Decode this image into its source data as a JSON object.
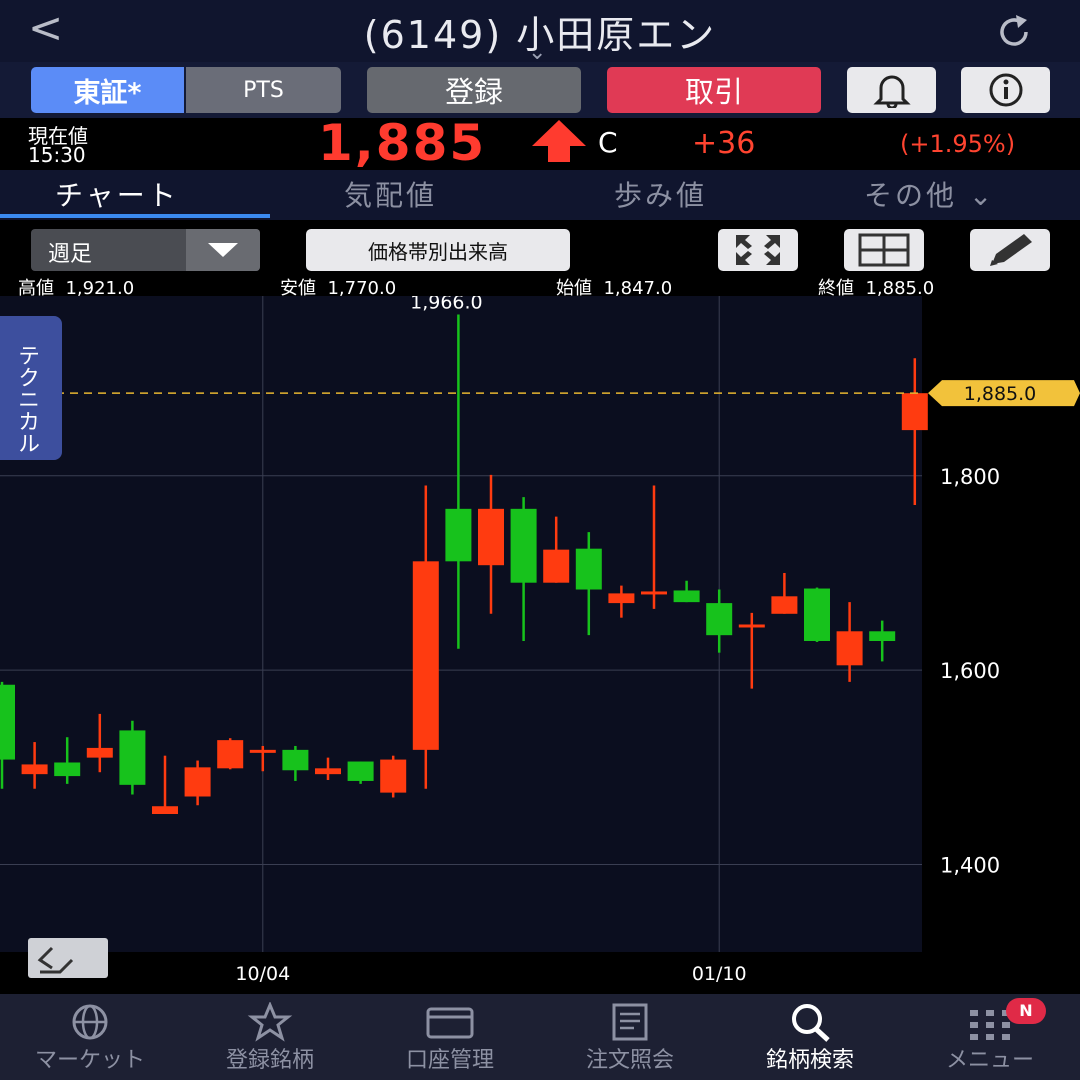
{
  "header": {
    "back_glyph": "<",
    "title": "(6149) 小田原エン",
    "title_chevron": "⌄",
    "refresh_icon": "refresh-icon"
  },
  "toolbar": {
    "tse_label": "東証*",
    "pts_label": "PTS",
    "register_label": "登録",
    "trade_label": "取引",
    "bell_icon": "bell-icon",
    "info_icon": "info-icon"
  },
  "price": {
    "label": "現在値",
    "time": "15:30",
    "value": "1,885",
    "flag": "C",
    "change": "+36",
    "change_pct": "(+1.95%)",
    "up_color": "#ff3b2f"
  },
  "tabs": [
    {
      "label": "チャート",
      "active": true
    },
    {
      "label": "気配値"
    },
    {
      "label": "歩み値"
    },
    {
      "label": "その他 ⌄"
    }
  ],
  "controls": {
    "period": "週足",
    "volume_button": "価格帯別出来高"
  },
  "ohlc": [
    {
      "label": "高値",
      "value": "1,921.0"
    },
    {
      "label": "安値",
      "value": "1,770.0"
    },
    {
      "label": "始値",
      "value": "1,847.0"
    },
    {
      "label": "終値",
      "value": "1,885.0"
    }
  ],
  "chart_data": {
    "type": "candlestick",
    "y_axis": {
      "ticks": [
        1400,
        1600,
        1800
      ],
      "tick_labels": [
        "1,400",
        "1,600",
        "1,800"
      ],
      "range": [
        1310,
        1985
      ]
    },
    "x_axis": {
      "tick_labels": [
        "10/04",
        "01/10"
      ],
      "tick_index": [
        8,
        22
      ]
    },
    "high_annotation": "1,966.0",
    "current_label": "1,885.0",
    "current_value": 1885,
    "up_color": "#17c21c",
    "down_color": "#ff3b10",
    "candles": [
      {
        "o": 1508,
        "h": 1588,
        "l": 1478,
        "c": 1585
      },
      {
        "o": 1503,
        "h": 1526,
        "l": 1478,
        "c": 1493
      },
      {
        "o": 1491,
        "h": 1531,
        "l": 1483,
        "c": 1505
      },
      {
        "o": 1520,
        "h": 1555,
        "l": 1495,
        "c": 1510
      },
      {
        "o": 1482,
        "h": 1548,
        "l": 1472,
        "c": 1538
      },
      {
        "o": 1460,
        "h": 1512,
        "l": 1454,
        "c": 1452
      },
      {
        "o": 1500,
        "h": 1507,
        "l": 1461,
        "c": 1470
      },
      {
        "o": 1528,
        "h": 1530,
        "l": 1498,
        "c": 1499
      },
      {
        "o": 1518,
        "h": 1522,
        "l": 1496,
        "c": 1518
      },
      {
        "o": 1497,
        "h": 1522,
        "l": 1486,
        "c": 1518
      },
      {
        "o": 1499,
        "h": 1510,
        "l": 1487,
        "c": 1493
      },
      {
        "o": 1486,
        "h": 1506,
        "l": 1483,
        "c": 1506
      },
      {
        "o": 1508,
        "h": 1512,
        "l": 1469,
        "c": 1474
      },
      {
        "o": 1712,
        "h": 1790,
        "l": 1478,
        "c": 1518
      },
      {
        "o": 1712,
        "h": 1966,
        "l": 1622,
        "c": 1766
      },
      {
        "o": 1766,
        "h": 1801,
        "l": 1658,
        "c": 1708
      },
      {
        "o": 1690,
        "h": 1778,
        "l": 1630,
        "c": 1766
      },
      {
        "o": 1724,
        "h": 1758,
        "l": 1690,
        "c": 1690
      },
      {
        "o": 1683,
        "h": 1742,
        "l": 1636,
        "c": 1725
      },
      {
        "o": 1679,
        "h": 1687,
        "l": 1654,
        "c": 1669
      },
      {
        "o": 1681,
        "h": 1790,
        "l": 1663,
        "c": 1681
      },
      {
        "o": 1670,
        "h": 1692,
        "l": 1670,
        "c": 1682
      },
      {
        "o": 1636,
        "h": 1683,
        "l": 1618,
        "c": 1669
      },
      {
        "o": 1647,
        "h": 1659,
        "l": 1581,
        "c": 1646
      },
      {
        "o": 1676,
        "h": 1700,
        "l": 1658,
        "c": 1658
      },
      {
        "o": 1630,
        "h": 1685,
        "l": 1629,
        "c": 1684
      },
      {
        "o": 1640,
        "h": 1670,
        "l": 1588,
        "c": 1605
      },
      {
        "o": 1630,
        "h": 1651,
        "l": 1609,
        "c": 1640
      },
      {
        "o": 1885,
        "h": 1921,
        "l": 1770,
        "c": 1847
      }
    ]
  },
  "technical_label": "テクニカル",
  "nav": [
    {
      "label": "マーケット",
      "icon": "globe-icon"
    },
    {
      "label": "登録銘柄",
      "icon": "star-icon"
    },
    {
      "label": "口座管理",
      "icon": "card-icon"
    },
    {
      "label": "注文照会",
      "icon": "document-icon"
    },
    {
      "label": "銘柄検索",
      "icon": "search-icon",
      "active": true
    },
    {
      "label": "メニュー",
      "icon": "grid-menu-icon",
      "badge": "N"
    }
  ]
}
